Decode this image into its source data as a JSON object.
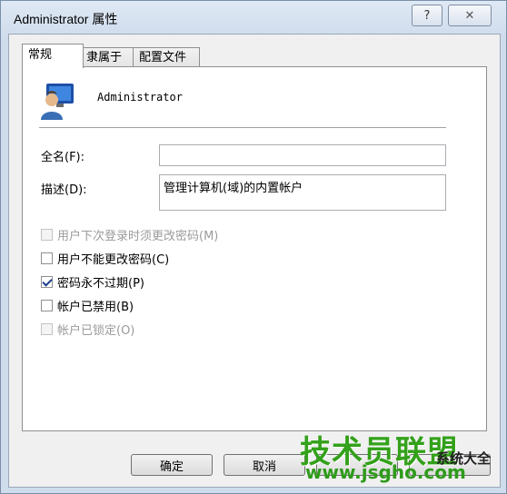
{
  "window": {
    "title": "Administrator 属性",
    "help_glyph": "?",
    "close_glyph": "✕"
  },
  "tabs": [
    {
      "label": "常规",
      "active": true
    },
    {
      "label": "隶属于",
      "active": false
    },
    {
      "label": "配置文件",
      "active": false
    }
  ],
  "general": {
    "username": "Administrator",
    "fullname_label": "全名(F):",
    "fullname_value": "",
    "description_label": "描述(D):",
    "description_value": "管理计算机(域)的内置帐户",
    "options": [
      {
        "label": "用户下次登录时须更改密码(M)",
        "checked": false,
        "enabled": false
      },
      {
        "label": "用户不能更改密码(C)",
        "checked": false,
        "enabled": true
      },
      {
        "label": "密码永不过期(P)",
        "checked": true,
        "enabled": true
      },
      {
        "label": "帐户已禁用(B)",
        "checked": false,
        "enabled": true
      },
      {
        "label": "帐户已锁定(O)",
        "checked": false,
        "enabled": false
      }
    ]
  },
  "buttons": {
    "ok": "确定",
    "cancel": "取消",
    "apply": "",
    "help": ""
  },
  "watermark": {
    "brand": "技术员联盟",
    "url": "www.jsgho.com",
    "side": "系统大全"
  },
  "colors": {
    "accent_checkmark": "#1c3d8c",
    "watermark_green": "#33a11a"
  }
}
